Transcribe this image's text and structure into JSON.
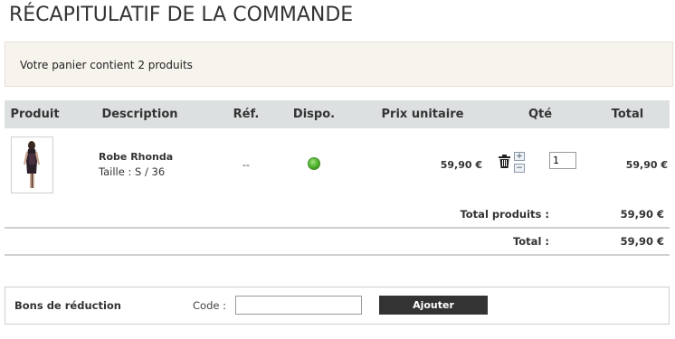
{
  "page": {
    "title": "RÉCAPITULATIF DE LA COMMANDE"
  },
  "notice": {
    "text": "Votre panier contient 2 produits"
  },
  "table": {
    "headers": {
      "product": "Produit",
      "description": "Description",
      "ref": "Réf.",
      "availability": "Dispo.",
      "unit_price": "Prix unitaire",
      "qty": "Qté",
      "total": "Total"
    },
    "items": [
      {
        "name": "Robe Rhonda",
        "size": "Taille : S / 36",
        "ref": "--",
        "availability_color": "#4caf2a",
        "unit_price": "59,90 €",
        "qty": "1",
        "total": "59,90 €"
      }
    ],
    "totals": {
      "products_label": "Total produits :",
      "products_value": "59,90 €",
      "grand_label": "Total :",
      "grand_value": "59,90 €"
    }
  },
  "voucher": {
    "title": "Bons de réduction",
    "code_label": "Code :",
    "code_value": "",
    "button_label": "Ajouter"
  },
  "icons": {
    "trash": "trash-icon",
    "plus": "+",
    "minus": "−"
  }
}
